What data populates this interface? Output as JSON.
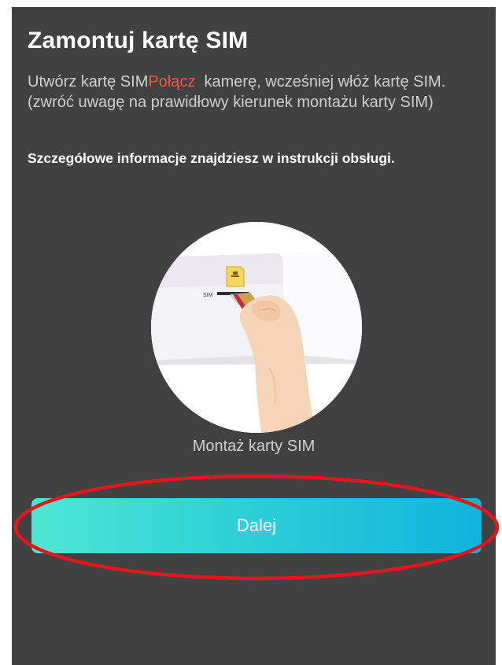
{
  "header": {
    "title": "Zamontuj kartę SIM"
  },
  "instructions": {
    "text_before": "Utwórz kartę SIM",
    "accent_text": "Połącz",
    "text_after": "  kamerę, wcześniej włóż kartę SIM. (zwróć uwagę na prawidłowy kierunek montażu karty SIM)",
    "manual_note": "Szczegółowe informacje znajdziesz w instrukcji obsługi."
  },
  "illustration": {
    "slot_label": "SIM",
    "caption": "Montaż karty SIM"
  },
  "actions": {
    "next_label": "Dalej"
  },
  "colors": {
    "background": "#414141",
    "accent": "#ef5b3f",
    "button_gradient_start": "#4ee6d3",
    "button_gradient_end": "#10b4dc",
    "highlight": "#e8141c"
  }
}
